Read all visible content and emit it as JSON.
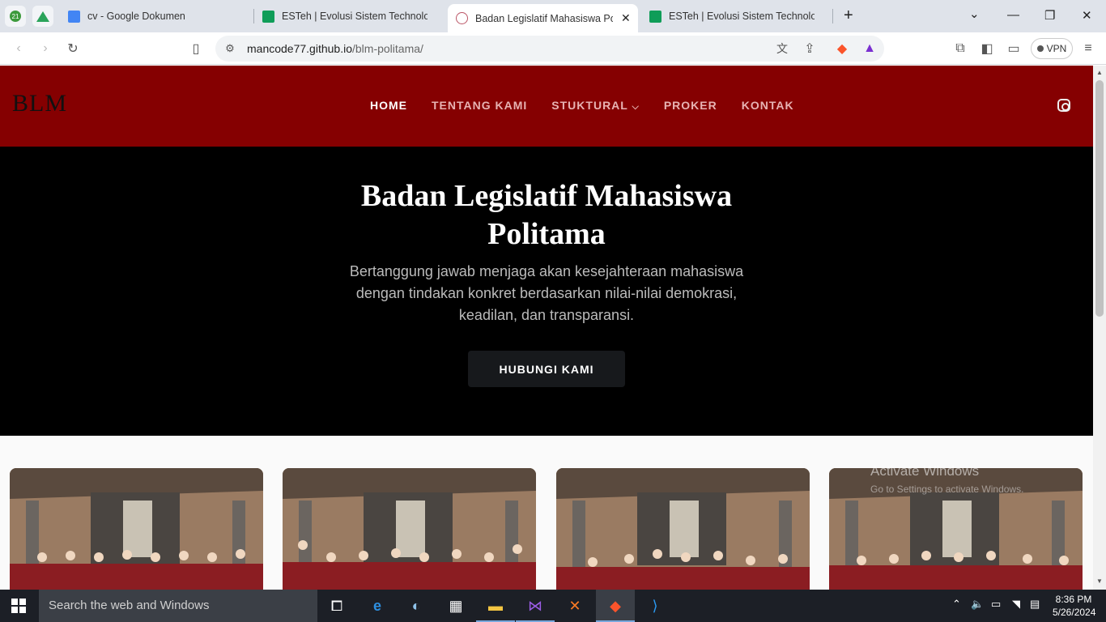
{
  "browser": {
    "tabs": [
      {
        "title": "cv - Google Dokumen",
        "favicon": "google-docs-icon",
        "color": "#4285f4"
      },
      {
        "title": "ESTeh | Evolusi Sistem Technologi",
        "favicon": "sheets-icon",
        "color": "#0f9d58"
      },
      {
        "title": "Badan Legislatif Mahasiswa Polit",
        "favicon": "blm-logo-icon",
        "active": true
      },
      {
        "title": "ESTeh | Evolusi Sistem Technologi",
        "favicon": "sheets-icon",
        "color": "#0f9d58"
      }
    ],
    "pinned_badge": "21",
    "url_host": "mancode77.github.io",
    "url_path": "/blm-politama/",
    "vpn_label": "VPN"
  },
  "site": {
    "logo": "BLM",
    "nav": [
      {
        "label": "HOME",
        "active": true
      },
      {
        "label": "TENTANG KAMI"
      },
      {
        "label": "STUKTURAL",
        "dropdown": true
      },
      {
        "label": "PROKER"
      },
      {
        "label": "KONTAK"
      }
    ],
    "hero": {
      "title": "Badan Legislatif Mahasiswa Politama",
      "subtitle": "Bertanggung jawab menjaga akan kesejahteraan mahasiswa dengan tindakan konkret berdasarkan nilai-nilai demokrasi, keadilan, dan transparansi.",
      "cta": "HUBUNGI KAMI"
    },
    "brand_color": "#850001"
  },
  "os": {
    "watermark_title": "Activate Windows",
    "watermark_sub": "Go to Settings to activate Windows.",
    "search_placeholder": "Search the web and Windows",
    "time": "8:36 PM",
    "date": "5/26/2024"
  }
}
